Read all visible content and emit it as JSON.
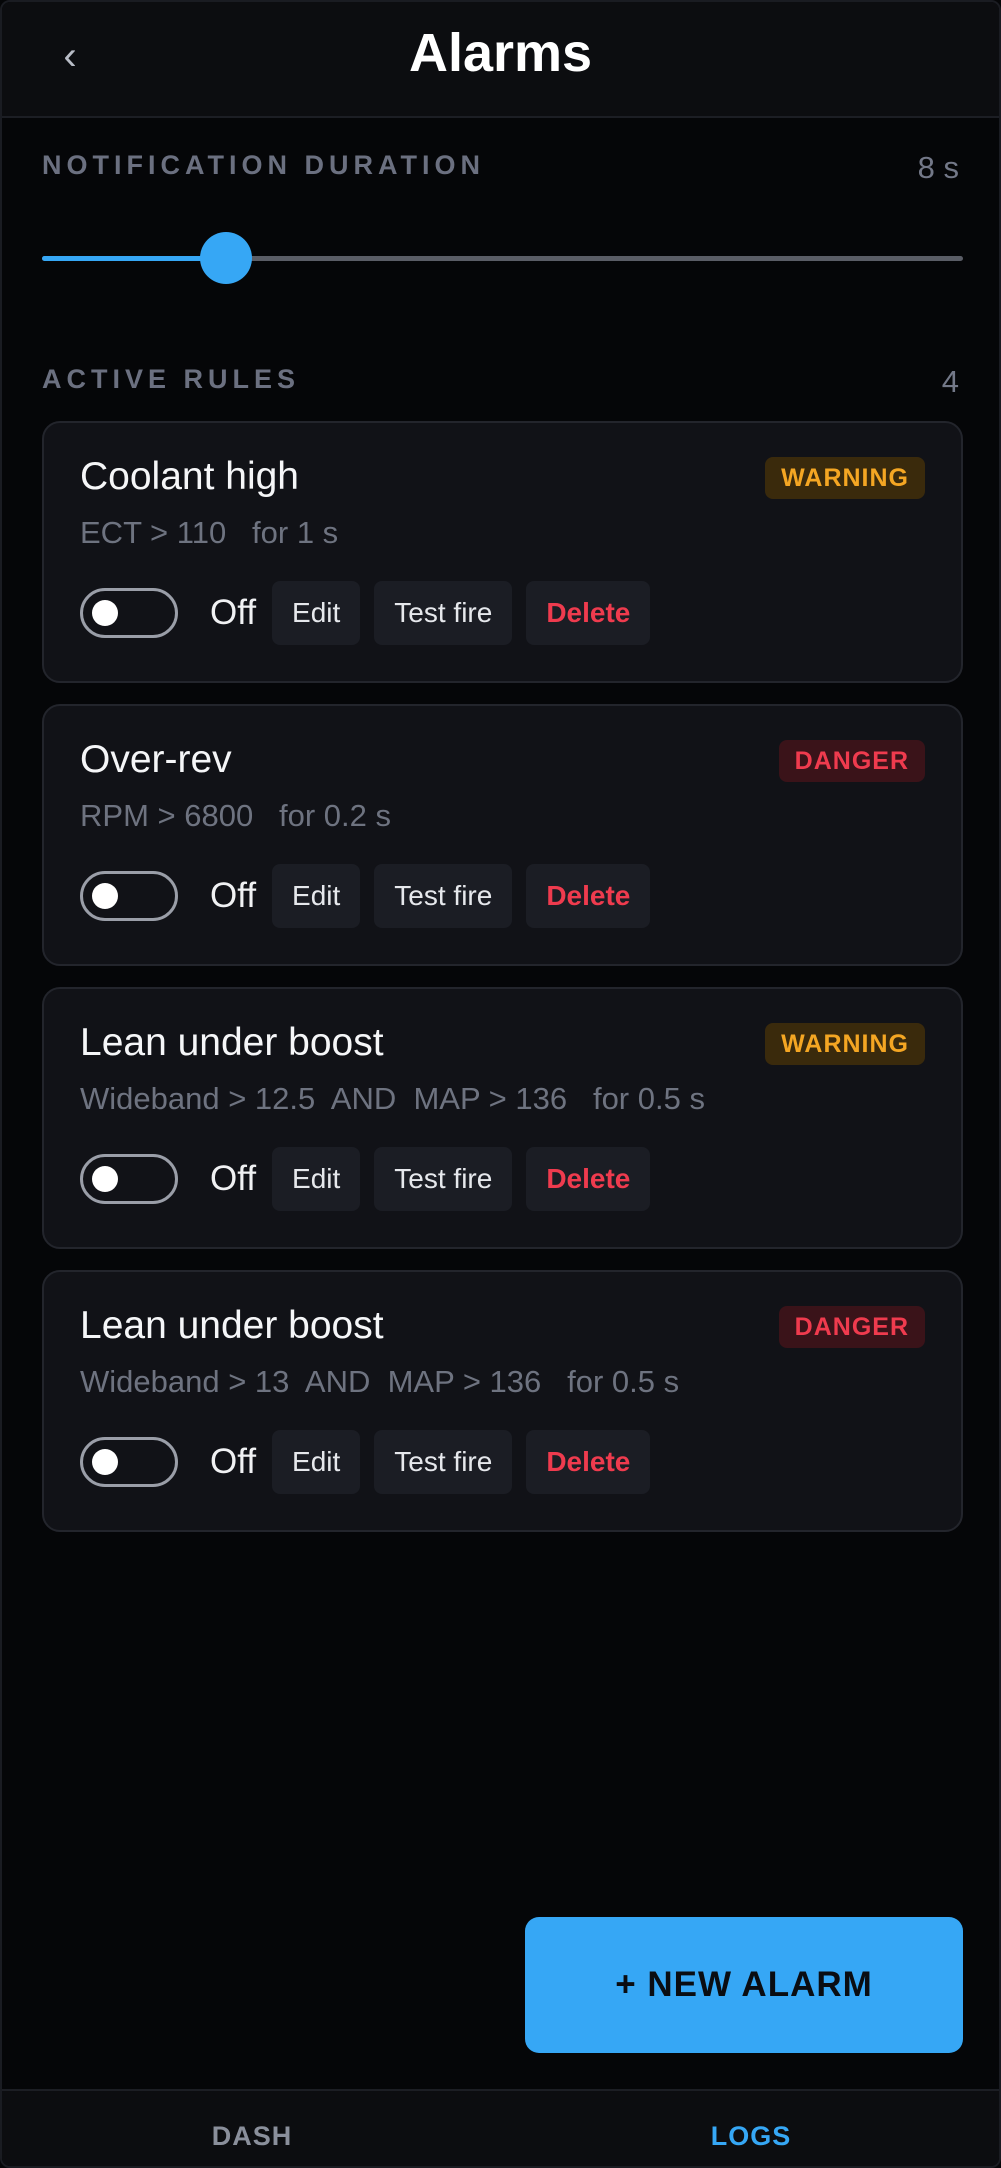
{
  "header": {
    "title": "Alarms",
    "back_icon": "chevron-left-icon",
    "back_glyph": "‹"
  },
  "notification": {
    "label": "NOTIFICATION DURATION",
    "value_text": "8 s",
    "slider_fraction": 0.2
  },
  "rules": {
    "label": "ACTIVE RULES",
    "count": "4",
    "items": [
      {
        "title": "Coolant high",
        "badge": "WARNING",
        "severity": "warning",
        "condition": "ECT > 110   for 1 s",
        "toggle_label": "Off",
        "enabled": false
      },
      {
        "title": "Over-rev",
        "badge": "DANGER",
        "severity": "danger",
        "condition": "RPM > 6800   for 0.2 s",
        "toggle_label": "Off",
        "enabled": false
      },
      {
        "title": "Lean under boost",
        "badge": "WARNING",
        "severity": "warning",
        "condition": "Wideband > 12.5  AND  MAP > 136   for 0.5 s",
        "toggle_label": "Off",
        "enabled": false
      },
      {
        "title": "Lean under boost",
        "badge": "DANGER",
        "severity": "danger",
        "condition": "Wideband > 13  AND  MAP > 136   for 0.5 s",
        "toggle_label": "Off",
        "enabled": false
      }
    ]
  },
  "actions": {
    "edit": "Edit",
    "test_fire": "Test fire",
    "delete": "Delete"
  },
  "new_alarm_label": "+ NEW ALARM",
  "nav": {
    "dash": "DASH",
    "logs": "LOGS",
    "active": "logs"
  },
  "colors": {
    "accent": "#36a7f5",
    "warning": "#f4a623",
    "danger": "#ef3b4e",
    "background": "#050608"
  }
}
